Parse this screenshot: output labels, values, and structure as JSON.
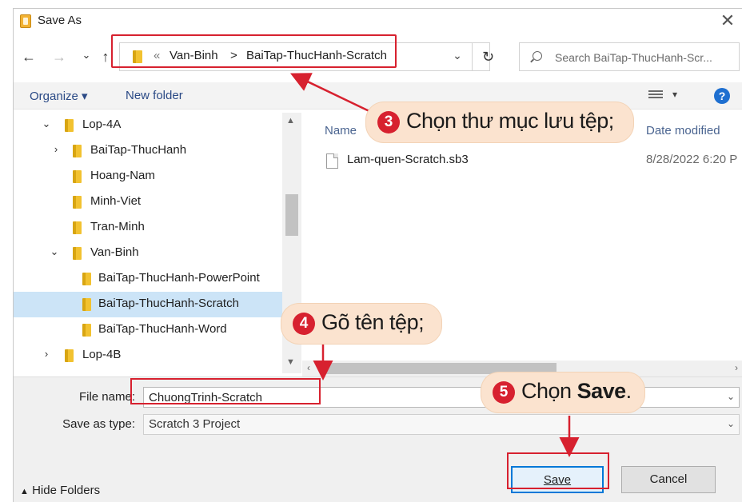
{
  "window": {
    "title": "Save As",
    "close_glyph": "✕"
  },
  "nav": {
    "back_glyph": "←",
    "forward_glyph": "→",
    "recent_glyph": "⌄",
    "up_glyph": "↑",
    "breadcrumb_overflow": "«",
    "breadcrumb": [
      "Van-Binh",
      "BaiTap-ThucHanh-Scratch"
    ],
    "separator": ">",
    "dropdown_glyph": "⌄",
    "refresh_glyph": "↻",
    "search_placeholder": "Search BaiTap-ThucHanh-Scr..."
  },
  "toolbar": {
    "organize_label": "Organize ▾",
    "new_folder_label": "New folder",
    "view_caret": "▾",
    "help_label": "?"
  },
  "tree": {
    "items": [
      {
        "label": "Lop-4A",
        "arrow": "⌄"
      },
      {
        "label": "BaiTap-ThucHanh",
        "arrow": "›"
      },
      {
        "label": "Hoang-Nam",
        "arrow": ""
      },
      {
        "label": "Minh-Viet",
        "arrow": ""
      },
      {
        "label": "Tran-Minh",
        "arrow": ""
      },
      {
        "label": "Van-Binh",
        "arrow": "⌄"
      },
      {
        "label": "BaiTap-ThucHanh-PowerPoint",
        "arrow": ""
      },
      {
        "label": "BaiTap-ThucHanh-Scratch",
        "arrow": "",
        "selected": true
      },
      {
        "label": "BaiTap-ThucHanh-Word",
        "arrow": ""
      },
      {
        "label": "Lop-4B",
        "arrow": "›"
      }
    ],
    "scroll_up": "▲",
    "scroll_down": "▼"
  },
  "files": {
    "columns": {
      "name": "Name",
      "date": "Date modified"
    },
    "rows": [
      {
        "name": "Lam-quen-Scratch.sb3",
        "date": "8/28/2022 6:20 P"
      }
    ],
    "scroll_left": "‹",
    "scroll_right": "›"
  },
  "form": {
    "file_name_label": "File name:",
    "file_name_value": "ChuongTrinh-Scratch",
    "save_type_label": "Save as type:",
    "save_type_value": "Scratch 3 Project",
    "caret": "⌄",
    "hide_folders_label": "Hide Folders",
    "hide_folders_glyph": "▲",
    "save_label": "Save",
    "cancel_label": "Cancel"
  },
  "annotations": {
    "step3": {
      "num": "3",
      "text": "Chọn thư mục lưu tệp;"
    },
    "step4": {
      "num": "4",
      "text": "Gõ tên tệp;"
    },
    "step5": {
      "num": "5",
      "text_prefix": "Chọn ",
      "text_bold": "Save",
      "text_suffix": "."
    }
  },
  "colors": {
    "highlight_red": "#d7212f",
    "callout_bg": "#fbe3cf",
    "selected_row": "#cce4f7",
    "link_blue": "#2b4a86"
  }
}
